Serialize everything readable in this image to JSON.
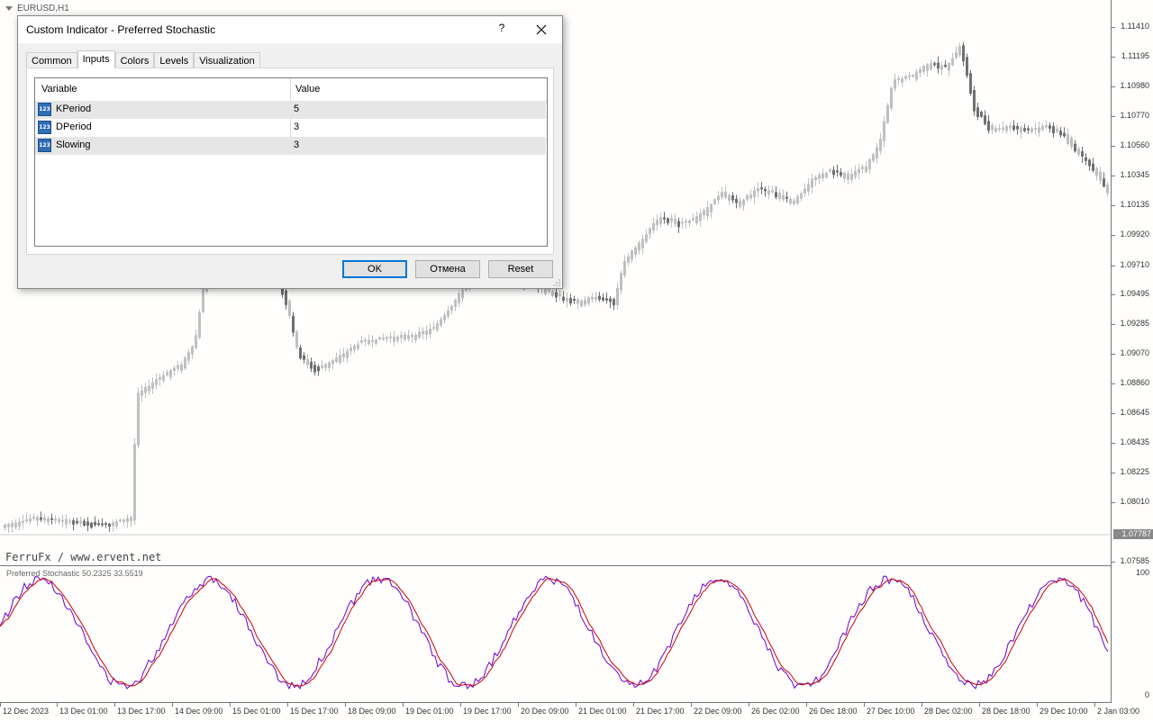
{
  "chart": {
    "symbol_label": "EURUSD,H1",
    "watermark": "FerruFx / www.ervent.net",
    "current_price": "1.07787",
    "price_labels": [
      "1.11410",
      "1.11195",
      "1.10980",
      "1.10770",
      "1.10560",
      "1.10345",
      "1.10135",
      "1.09920",
      "1.09710",
      "1.09495",
      "1.09285",
      "1.09070",
      "1.08860",
      "1.08645",
      "1.08435",
      "1.08225",
      "1.08010",
      "1.07585"
    ],
    "indicator_label": "Preferred Stochastic 50.2325 33.5519",
    "indicator_scale": [
      "100",
      "0"
    ],
    "time_labels": [
      "12 Dec 2023",
      "13 Dec 01:00",
      "13 Dec 17:00",
      "14 Dec 09:00",
      "15 Dec 01:00",
      "15 Dec 17:00",
      "18 Dec 09:00",
      "19 Dec 01:00",
      "19 Dec 17:00",
      "20 Dec 09:00",
      "21 Dec 01:00",
      "21 Dec 17:00",
      "22 Dec 09:00",
      "26 Dec 02:00",
      "26 Dec 18:00",
      "27 Dec 10:00",
      "28 Dec 02:00",
      "28 Dec 18:00",
      "29 Dec 10:00",
      "2 Jan 03:00"
    ],
    "colors": {
      "bull": "#c0c0c0",
      "bear": "#707070",
      "main_line": "#cc0000",
      "signal_line": "#6a00d0"
    }
  },
  "dialog": {
    "title": "Custom Indicator - Preferred Stochastic",
    "help_label": "?",
    "tabs": [
      "Common",
      "Inputs",
      "Colors",
      "Levels",
      "Visualization"
    ],
    "active_tab": "Inputs",
    "columns": [
      "Variable",
      "Value"
    ],
    "rows": [
      {
        "icon": "123",
        "variable": "KPeriod",
        "value": "5"
      },
      {
        "icon": "123",
        "variable": "DPeriod",
        "value": "3"
      },
      {
        "icon": "123",
        "variable": "Slowing",
        "value": "3"
      }
    ],
    "buttons": {
      "ok": "OK",
      "cancel": "Отмена",
      "reset": "Reset"
    }
  }
}
